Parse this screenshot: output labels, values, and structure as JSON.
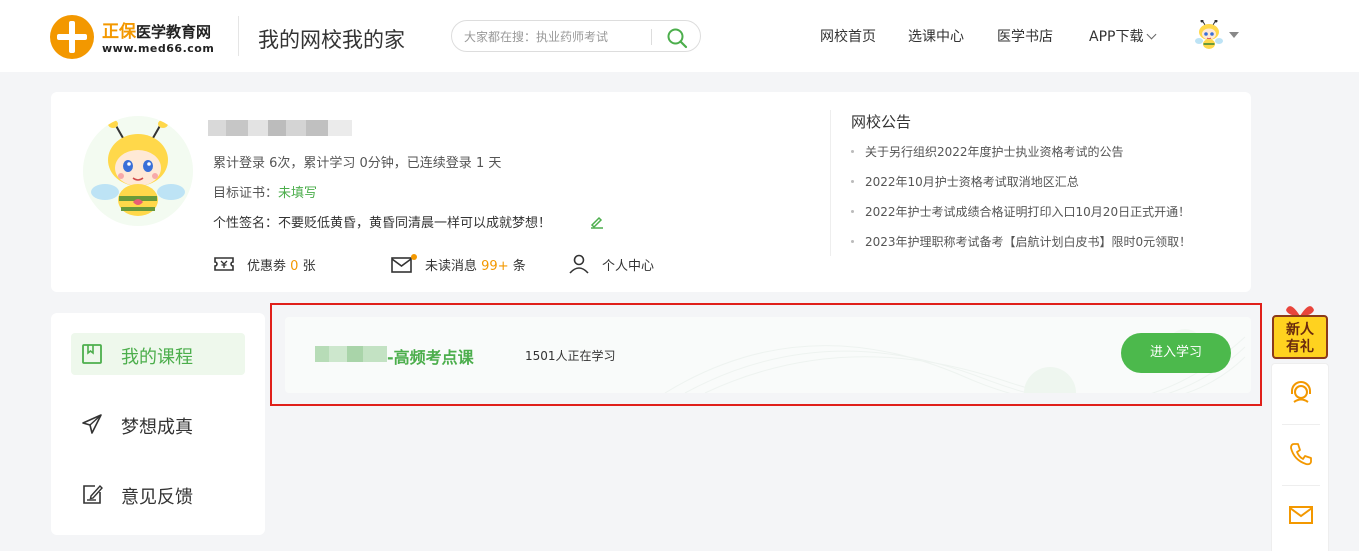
{
  "header": {
    "logo": {
      "brand_cn": "正保",
      "brand_sub": "医学教育网",
      "url": "www.med66.com"
    },
    "slogan": "我的网校我的家",
    "search": {
      "placeholder": "大家都在搜：执业药师考试",
      "icon": "search-icon"
    },
    "nav": [
      {
        "label": "网校首页"
      },
      {
        "label": "选课中心"
      },
      {
        "label": "医学书店"
      },
      {
        "label": "APP下载"
      }
    ],
    "avatar_icon": "bee-avatar-icon"
  },
  "profile": {
    "stats_text": "累计登录 6次，累计学习 0分钟，已连续登录 1 天",
    "target_label": "目标证书：",
    "target_value": "未填写",
    "signature_text": "个性签名：不要贬低黄昏，黄昏同清晨一样可以成就梦想！",
    "quick_links": {
      "coupon": {
        "prefix": "优惠劵",
        "count": "0",
        "suffix": "张"
      },
      "messages": {
        "prefix": "未读消息",
        "count": "99+",
        "suffix": "条"
      },
      "center": {
        "label": "个人中心"
      }
    }
  },
  "notice": {
    "title": "网校公告",
    "items": [
      {
        "text": "关于另行组织2022年度护士执业资格考试的公告"
      },
      {
        "text": "2022年10月护士资格考试取消地区汇总"
      },
      {
        "text": "2022年护士考试成绩合格证明打印入口10月20日正式开通！"
      },
      {
        "text": "2023年护理职称考试备考【启航计划白皮书】限时0元领取！"
      }
    ]
  },
  "menu": [
    {
      "label": "我的课程",
      "icon": "course-book-icon",
      "active": true
    },
    {
      "label": "梦想成真",
      "icon": "paper-plane-icon",
      "active": false
    },
    {
      "label": "意见反馈",
      "icon": "feedback-edit-icon",
      "active": false
    }
  ],
  "course": {
    "name_suffix": "-高频考点课",
    "learners": "1501人正在学习",
    "enter_label": "进入学习"
  },
  "float": {
    "gift_line1": "新人",
    "gift_line2": "有礼",
    "icons": [
      "customer-service-icon",
      "phone-icon",
      "mail-icon"
    ]
  },
  "colors": {
    "brand_orange": "#f39800",
    "green": "#4cae4c",
    "button_green": "#4cb94c",
    "highlight_red": "#e0201a"
  }
}
